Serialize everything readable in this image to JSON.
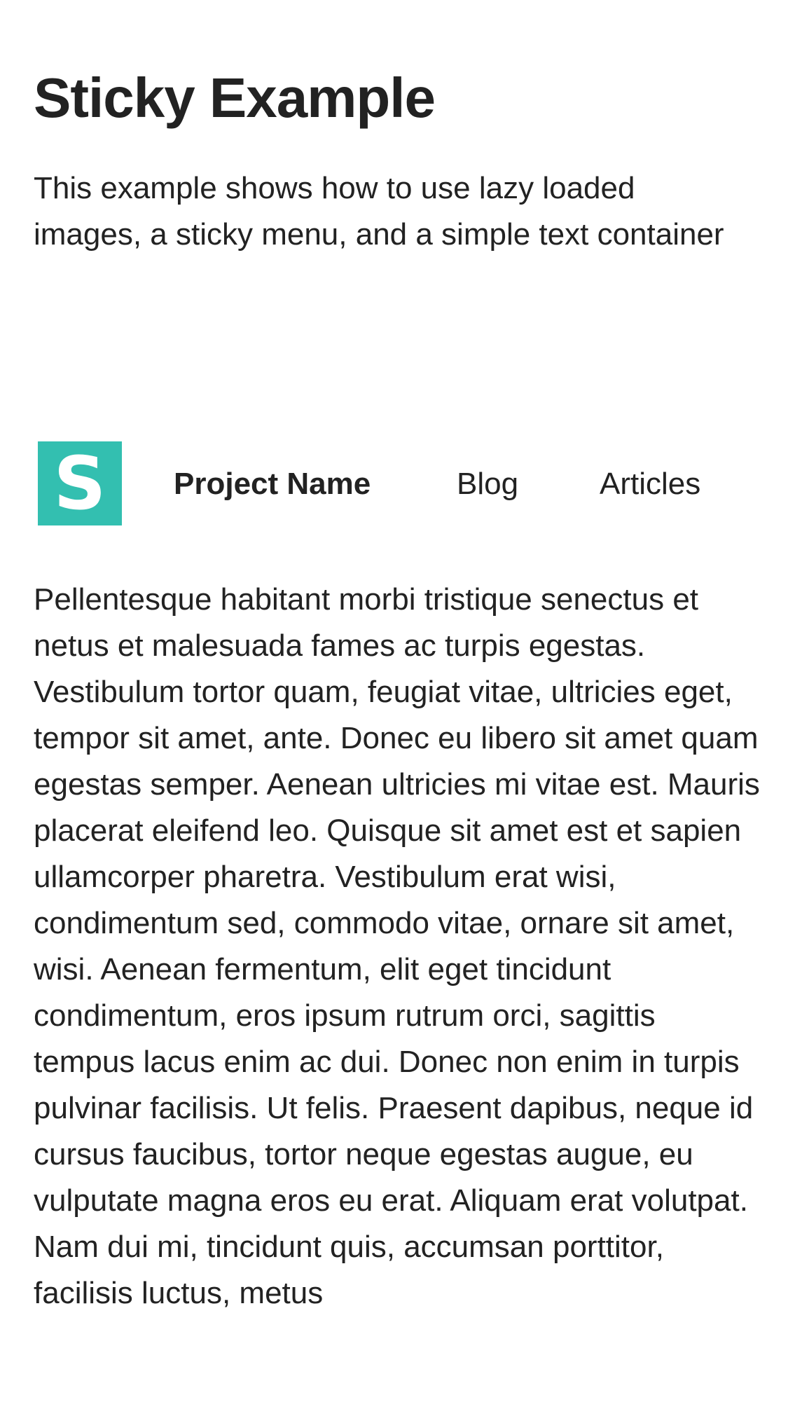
{
  "header": {
    "title": "Sticky Example",
    "description": "This example shows how to use lazy loaded images, a sticky menu, and a simple text container"
  },
  "nav": {
    "logo_letter": "S",
    "logo_color": "#33bfb0",
    "brand": "Project Name",
    "items": [
      {
        "label": "Blog"
      },
      {
        "label": "Articles"
      }
    ]
  },
  "content": {
    "paragraph": "Pellentesque habitant morbi tristique senectus et netus et malesuada fames ac turpis egestas. Vestibulum tortor quam, feugiat vitae, ultricies eget, tempor sit amet, ante. Donec eu libero sit amet quam egestas semper. Aenean ultricies mi vitae est. Mauris placerat eleifend leo. Quisque sit amet est et sapien ullamcorper pharetra. Vestibulum erat wisi, condimentum sed, commodo vitae, ornare sit amet, wisi. Aenean fermentum, elit eget tincidunt condimentum, eros ipsum rutrum orci, sagittis tempus lacus enim ac dui. Donec non enim in turpis pulvinar facilisis. Ut felis. Praesent dapibus, neque id cursus faucibus, tortor neque egestas augue, eu vulputate magna eros eu erat. Aliquam erat volutpat. Nam dui mi, tincidunt quis, accumsan porttitor, facilisis luctus, metus"
  }
}
